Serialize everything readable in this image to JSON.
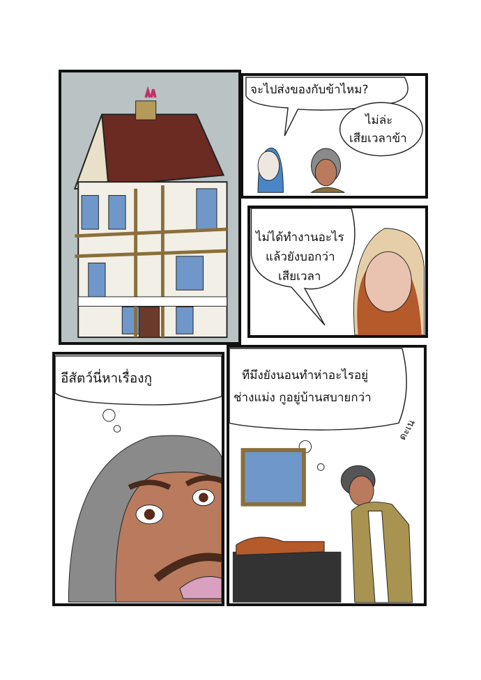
{
  "panels": [
    {
      "id": "house"
    },
    {
      "speech": [
        "จะไปส่งของกับข้าไหม?",
        "ไม่ล่ะ",
        "เสียเวลาข้า"
      ]
    },
    {
      "speech": [
        "ไม่ได้ทำงานอะไร",
        "แล้วยังบอกว่า",
        "เสียเวลา"
      ]
    },
    {
      "thought": "อีสัตว์นี่หาเรื่องกู"
    },
    {
      "speech": [
        "ทีมึงยังนอนทำห่าอะไรอยู่",
        "ช่างแม่ง กูอยู่บ้านสบายกว่า"
      ],
      "sfx": "ดะเน"
    }
  ],
  "colors": {
    "sky": "#b9c3c3",
    "roof": "#6b2a22",
    "window": "#6f97c9",
    "skin": "#b97a5e",
    "hood": "#8a8a8a",
    "wood": "#8a6f3a"
  }
}
